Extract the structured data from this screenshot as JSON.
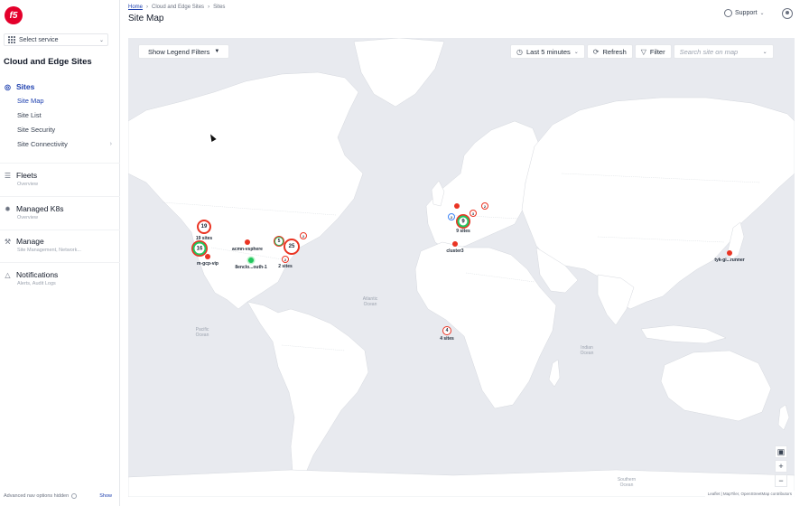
{
  "sidebar": {
    "logo_text": "f5",
    "service_select": "Select service",
    "workspace_title": "Cloud and Edge Sites",
    "sites": {
      "label": "Sites",
      "items": [
        {
          "label": "Site Map"
        },
        {
          "label": "Site List"
        },
        {
          "label": "Site Security"
        },
        {
          "label": "Site Connectivity"
        }
      ]
    },
    "groups": [
      {
        "label": "Fleets",
        "sub": "Overview",
        "icon": "fleets-icon"
      },
      {
        "label": "Managed K8s",
        "sub": "Overview",
        "icon": "k8s-icon"
      },
      {
        "label": "Manage",
        "sub": "Site Management, Network...",
        "icon": "wrench-icon"
      },
      {
        "label": "Notifications",
        "sub": "Alerts, Audit Logs",
        "icon": "bell-icon"
      }
    ],
    "footer": {
      "text": "Advanced nav options hidden",
      "link": "Show"
    }
  },
  "header": {
    "breadcrumb": [
      "Home",
      "Cloud and Edge Sites",
      "Sites"
    ],
    "title": "Site Map",
    "support": "Support"
  },
  "map": {
    "legend_button": "Show Legend Filters",
    "time_range": "Last 5 minutes",
    "refresh": "Refresh",
    "filter": "Filter",
    "search_placeholder": "Search site on map",
    "clusters": [
      {
        "count": "19",
        "label": "19 sites",
        "status": "red"
      },
      {
        "count": "16",
        "status": "green"
      },
      {
        "count": "25",
        "label": "2 sites",
        "status": "red"
      },
      {
        "count": "5",
        "status": "green"
      },
      {
        "count": "2",
        "status": "red"
      },
      {
        "count": "2",
        "status": "red"
      },
      {
        "count": "9",
        "label": "9 sites",
        "status": "green"
      },
      {
        "count": "2",
        "status": "blue"
      },
      {
        "count": "3",
        "status": "red"
      },
      {
        "count": "2",
        "status": "red"
      },
      {
        "count": "4",
        "label": "4 sites",
        "status": "red"
      }
    ],
    "sites": [
      {
        "label": "m-gcp-vip",
        "status": "red"
      },
      {
        "label": "acmn-vsphere",
        "status": "red"
      },
      {
        "label": "8enclo...outh-1",
        "status": "green"
      },
      {
        "label": "cluster3",
        "status": "red"
      },
      {
        "label": "tyk-gi...runner",
        "status": "red"
      },
      {
        "label": "",
        "status": "red"
      }
    ],
    "oceans": [
      {
        "name": "Atlantic\nOcean"
      },
      {
        "name": "Pacific\nOcean"
      },
      {
        "name": "Indian\nOcean"
      },
      {
        "name": "Southern\nOcean"
      }
    ],
    "attribution": "Leaflet | MapTiler, OpenStreetMap contributors",
    "colors": {
      "red": "#ea3423",
      "green": "#22c55e",
      "blue": "#3b82f6",
      "accent": "#1e40af"
    }
  }
}
